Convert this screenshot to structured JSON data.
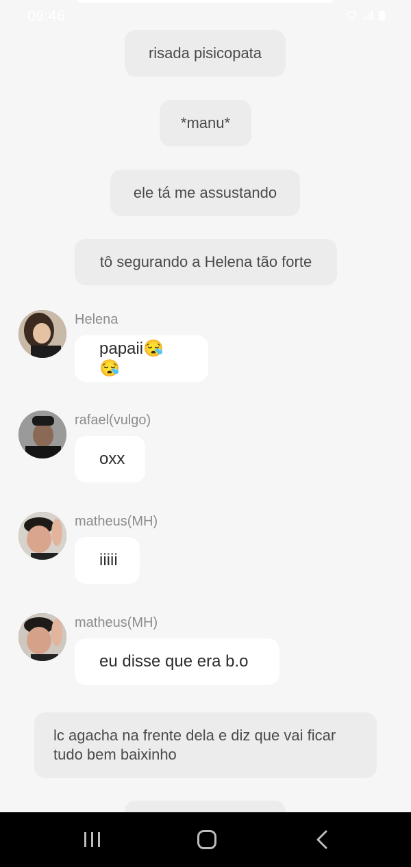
{
  "status_bar": {
    "time": "09:46"
  },
  "narrations": [
    {
      "text": "risada pisicopata"
    },
    {
      "text": "*manu*"
    },
    {
      "text": "ele tá me assustando"
    },
    {
      "text": "tô segurando a Helena tão forte"
    },
    {
      "text": "lc agacha na frente dela e diz que vai ficar tudo bem baixinho"
    }
  ],
  "messages": [
    {
      "sender": "Helena",
      "text": "papaii😪😪"
    },
    {
      "sender": "rafael(vulgo)",
      "text": "oxx"
    },
    {
      "sender": "matheus(MH)",
      "text": "iiiii"
    },
    {
      "sender": "matheus(MH)",
      "text": "eu disse que era b.o"
    }
  ]
}
